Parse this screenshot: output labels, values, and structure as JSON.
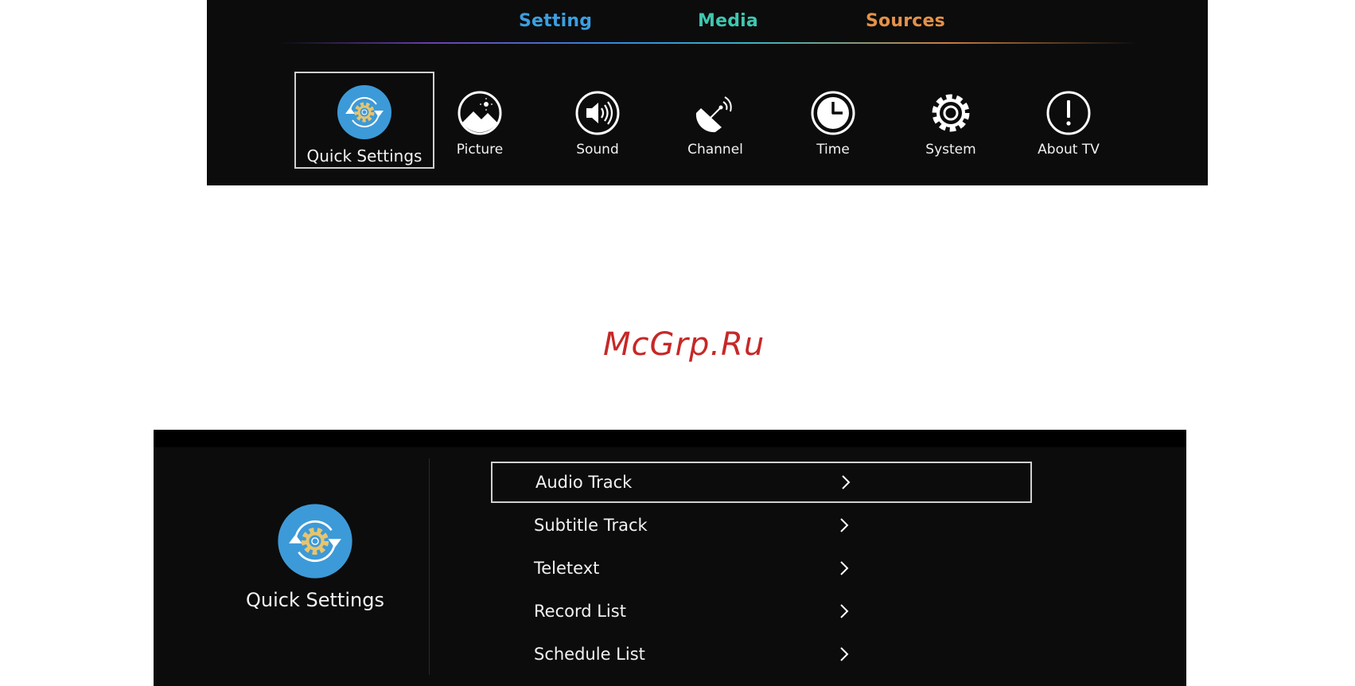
{
  "tabs": [
    {
      "label": "Setting",
      "color": "#3b9fe0"
    },
    {
      "label": "Media",
      "color": "#3ec7b0"
    },
    {
      "label": "Sources",
      "color": "#e3924a"
    }
  ],
  "menu": [
    {
      "label": "Quick Settings",
      "icon": "quick-settings-icon",
      "selected": true
    },
    {
      "label": "Picture",
      "icon": "picture-icon"
    },
    {
      "label": "Sound",
      "icon": "sound-icon"
    },
    {
      "label": "Channel",
      "icon": "channel-icon"
    },
    {
      "label": "Time",
      "icon": "time-icon"
    },
    {
      "label": "System",
      "icon": "system-icon"
    },
    {
      "label": "About TV",
      "icon": "about-tv-icon"
    }
  ],
  "watermark": "McGrp.Ru",
  "quick_settings": {
    "title": "Quick Settings",
    "items": [
      {
        "label": "Audio Track",
        "selected": true
      },
      {
        "label": "Subtitle Track"
      },
      {
        "label": "Teletext"
      },
      {
        "label": "Record List"
      },
      {
        "label": "Schedule List"
      }
    ]
  },
  "colors": {
    "panel": "#0c0c0c",
    "accent_blue": "#3b9fe0",
    "gear": "#e9c46a"
  }
}
